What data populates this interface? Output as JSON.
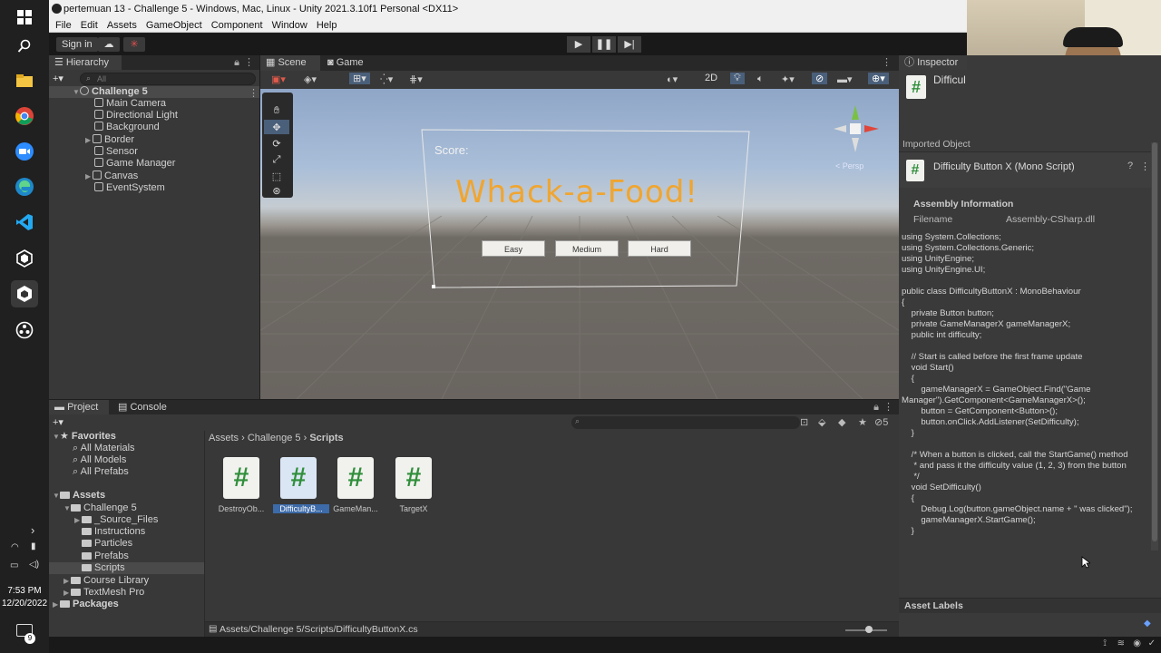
{
  "window": {
    "title": "pertemuan 13 - Challenge 5 - Windows, Mac, Linux - Unity 2021.3.10f1 Personal <DX11>"
  },
  "menu": [
    "File",
    "Edit",
    "Assets",
    "GameObject",
    "Component",
    "Window",
    "Help"
  ],
  "toolbar": {
    "sign_in": "Sign in"
  },
  "hierarchy": {
    "title": "Hierarchy",
    "search_placeholder": "All",
    "scene": "Challenge 5",
    "items": [
      "Main Camera",
      "Directional Light",
      "Background",
      "Border",
      "Sensor",
      "Game Manager",
      "Canvas",
      "EventSystem"
    ]
  },
  "scene_tabs": {
    "scene": "Scene",
    "game": "Game",
    "mode_2d": "2D"
  },
  "scene_view": {
    "score": "Score:",
    "game_title": "Whack-a-Food!",
    "buttons": [
      "Easy",
      "Medium",
      "Hard"
    ],
    "gizmo_label": "< Persp"
  },
  "project": {
    "tabs": [
      "Project",
      "Console"
    ],
    "favorites": {
      "title": "Favorites",
      "items": [
        "All Materials",
        "All Models",
        "All Prefabs"
      ]
    },
    "assets_title": "Assets",
    "challenge": "Challenge 5",
    "challenge_children": [
      "_Source_Files",
      "Instructions",
      "Particles",
      "Prefabs",
      "Scripts"
    ],
    "other_assets": [
      "Course Library",
      "TextMesh Pro"
    ],
    "packages": "Packages",
    "breadcrumb": [
      "Assets",
      "Challenge 5",
      "Scripts"
    ],
    "files": [
      "DestroyOb...",
      "DifficultyB...",
      "GameMan...",
      "TargetX"
    ],
    "hidden_count": "5",
    "status_path": "Assets/Challenge 5/Scripts/DifficultyButtonX.cs"
  },
  "inspector": {
    "title": "Inspector",
    "header_name": "Difficul",
    "imported_object": "Imported Object",
    "script_title": "Difficulty Button X (Mono Script)",
    "assembly_info": "Assembly Information",
    "filename_label": "Filename",
    "filename_value": "Assembly-CSharp.dll",
    "code": "using System.Collections;\nusing System.Collections.Generic;\nusing UnityEngine;\nusing UnityEngine.UI;\n\npublic class DifficultyButtonX : MonoBehaviour\n{\n    private Button button;\n    private GameManagerX gameManagerX;\n    public int difficulty;\n\n    // Start is called before the first frame update\n    void Start()\n    {\n        gameManagerX = GameObject.Find(\"Game Manager\").GetComponent<GameManagerX>();\n        button = GetComponent<Button>();\n        button.onClick.AddListener(SetDifficulty);\n    }\n\n    /* When a button is clicked, call the StartGame() method\n     * and pass it the difficulty value (1, 2, 3) from the button\n     */\n    void SetDifficulty()\n    {\n        Debug.Log(button.gameObject.name + \" was clicked\");\n        gameManagerX.StartGame();\n    }",
    "asset_labels": "Asset Labels"
  },
  "clock": {
    "time": "7:53 PM",
    "date": "12/20/2022"
  },
  "notif_count": "9"
}
